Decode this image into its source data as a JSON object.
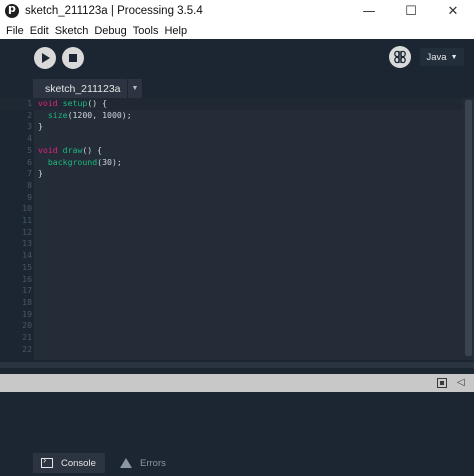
{
  "window": {
    "title": "sketch_211123a | Processing 3.5.4",
    "minimize_glyph": "—",
    "maximize_glyph": "☐",
    "close_glyph": "✕"
  },
  "menu": [
    "File",
    "Edit",
    "Sketch",
    "Debug",
    "Tools",
    "Help"
  ],
  "toolbar": {
    "mode_label": "Java",
    "mode_caret": "▼"
  },
  "tabs": [
    {
      "label": "sketch_211123a"
    }
  ],
  "tab_menu_glyph": "▼",
  "editor": {
    "lines": [
      {
        "n": "1",
        "kw": "void",
        "fn": "setup",
        "rest": "() {"
      },
      {
        "n": "2",
        "kw": "",
        "fn": "size",
        "rest": "(1200, 1000);"
      },
      {
        "n": "3",
        "kw": "",
        "fn": "",
        "rest": "}"
      },
      {
        "n": "4",
        "kw": "",
        "fn": "",
        "rest": ""
      },
      {
        "n": "5",
        "kw": "void",
        "fn": "draw",
        "rest": "() {"
      },
      {
        "n": "6",
        "kw": "",
        "fn": "background",
        "rest": "(30);"
      },
      {
        "n": "7",
        "kw": "",
        "fn": "",
        "rest": "}"
      },
      {
        "n": "8",
        "kw": "",
        "fn": "",
        "rest": ""
      },
      {
        "n": "9",
        "kw": "",
        "fn": "",
        "rest": ""
      },
      {
        "n": "10",
        "kw": "",
        "fn": "",
        "rest": ""
      },
      {
        "n": "11",
        "kw": "",
        "fn": "",
        "rest": ""
      },
      {
        "n": "12",
        "kw": "",
        "fn": "",
        "rest": ""
      },
      {
        "n": "13",
        "kw": "",
        "fn": "",
        "rest": ""
      },
      {
        "n": "14",
        "kw": "",
        "fn": "",
        "rest": ""
      },
      {
        "n": "15",
        "kw": "",
        "fn": "",
        "rest": ""
      },
      {
        "n": "16",
        "kw": "",
        "fn": "",
        "rest": ""
      },
      {
        "n": "17",
        "kw": "",
        "fn": "",
        "rest": ""
      },
      {
        "n": "18",
        "kw": "",
        "fn": "",
        "rest": ""
      },
      {
        "n": "19",
        "kw": "",
        "fn": "",
        "rest": ""
      },
      {
        "n": "20",
        "kw": "",
        "fn": "",
        "rest": ""
      },
      {
        "n": "21",
        "kw": "",
        "fn": "",
        "rest": ""
      },
      {
        "n": "22",
        "kw": "",
        "fn": "",
        "rest": ""
      }
    ]
  },
  "footer": {
    "console_label": "Console",
    "errors_label": "Errors"
  },
  "colors": {
    "toolbar_bg": "#1c2632",
    "editor_bg": "#232c37",
    "keyword": "#e2227f",
    "function": "#1db87e"
  }
}
